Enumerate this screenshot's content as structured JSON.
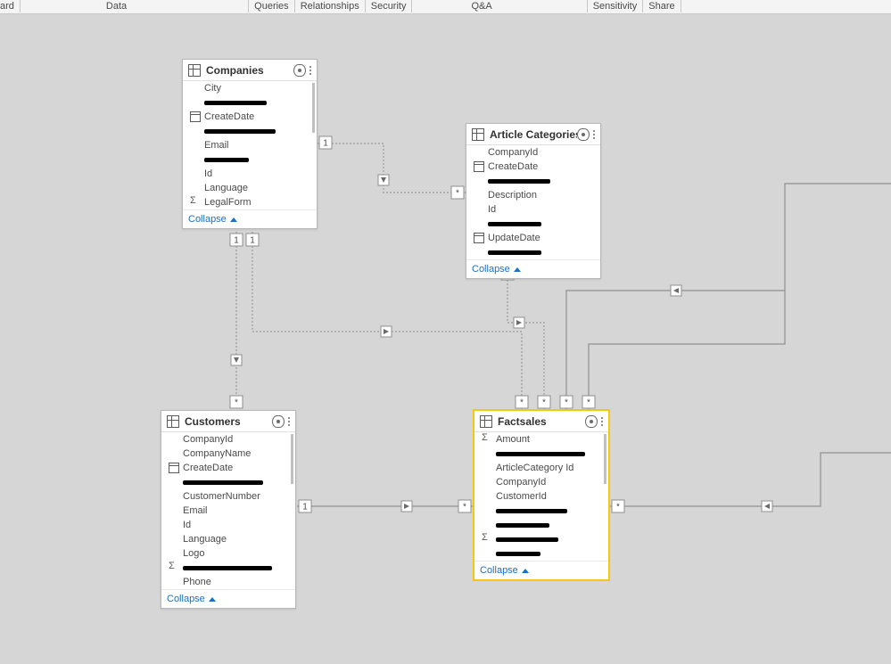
{
  "ribbon": {
    "items": [
      "ard",
      "Data",
      "Queries",
      "Relationships",
      "Security",
      "Q&A",
      "Sensitivity",
      "Share"
    ]
  },
  "collapse_label": "Collapse",
  "tables": {
    "companies": {
      "title": "Companies",
      "fields": [
        {
          "icon": "",
          "label": "City"
        },
        {
          "icon": "",
          "redact": 70
        },
        {
          "icon": "date",
          "label": "CreateDate"
        },
        {
          "icon": "",
          "redact": 80
        },
        {
          "icon": "",
          "label": "Email"
        },
        {
          "icon": "",
          "redact": 50
        },
        {
          "icon": "",
          "label": "Id"
        },
        {
          "icon": "",
          "label": "Language"
        },
        {
          "icon": "sigma",
          "label": "LegalForm"
        }
      ]
    },
    "article_categories": {
      "title": "Article Categories",
      "fields": [
        {
          "icon": "",
          "label": "CompanyId"
        },
        {
          "icon": "date",
          "label": "CreateDate"
        },
        {
          "icon": "",
          "redact": 70
        },
        {
          "icon": "",
          "label": "Description"
        },
        {
          "icon": "",
          "label": "Id"
        },
        {
          "icon": "",
          "redact": 60
        },
        {
          "icon": "date",
          "label": "UpdateDate"
        },
        {
          "icon": "",
          "redact": 60
        }
      ]
    },
    "customers": {
      "title": "Customers",
      "fields": [
        {
          "icon": "",
          "label": "CompanyId"
        },
        {
          "icon": "",
          "label": "CompanyName"
        },
        {
          "icon": "date",
          "label": "CreateDate"
        },
        {
          "icon": "",
          "redact": 90
        },
        {
          "icon": "",
          "label": "CustomerNumber"
        },
        {
          "icon": "",
          "label": "Email"
        },
        {
          "icon": "",
          "label": "Id"
        },
        {
          "icon": "",
          "label": "Language"
        },
        {
          "icon": "",
          "label": "Logo"
        },
        {
          "icon": "sigma",
          "redact": 100
        },
        {
          "icon": "",
          "label": "Phone"
        }
      ]
    },
    "factsales": {
      "title": "Factsales",
      "fields": [
        {
          "icon": "sigma",
          "label": "Amount"
        },
        {
          "icon": "",
          "redact": 100
        },
        {
          "icon": "",
          "label": "ArticleCategory Id"
        },
        {
          "icon": "",
          "label": "CompanyId"
        },
        {
          "icon": "",
          "label": "CustomerId"
        },
        {
          "icon": "",
          "redact": 80
        },
        {
          "icon": "",
          "redact": 60
        },
        {
          "icon": "sigma",
          "redact": 70
        },
        {
          "icon": "",
          "redact": 50
        }
      ]
    }
  },
  "markers": {
    "one": "1",
    "many": "*"
  }
}
